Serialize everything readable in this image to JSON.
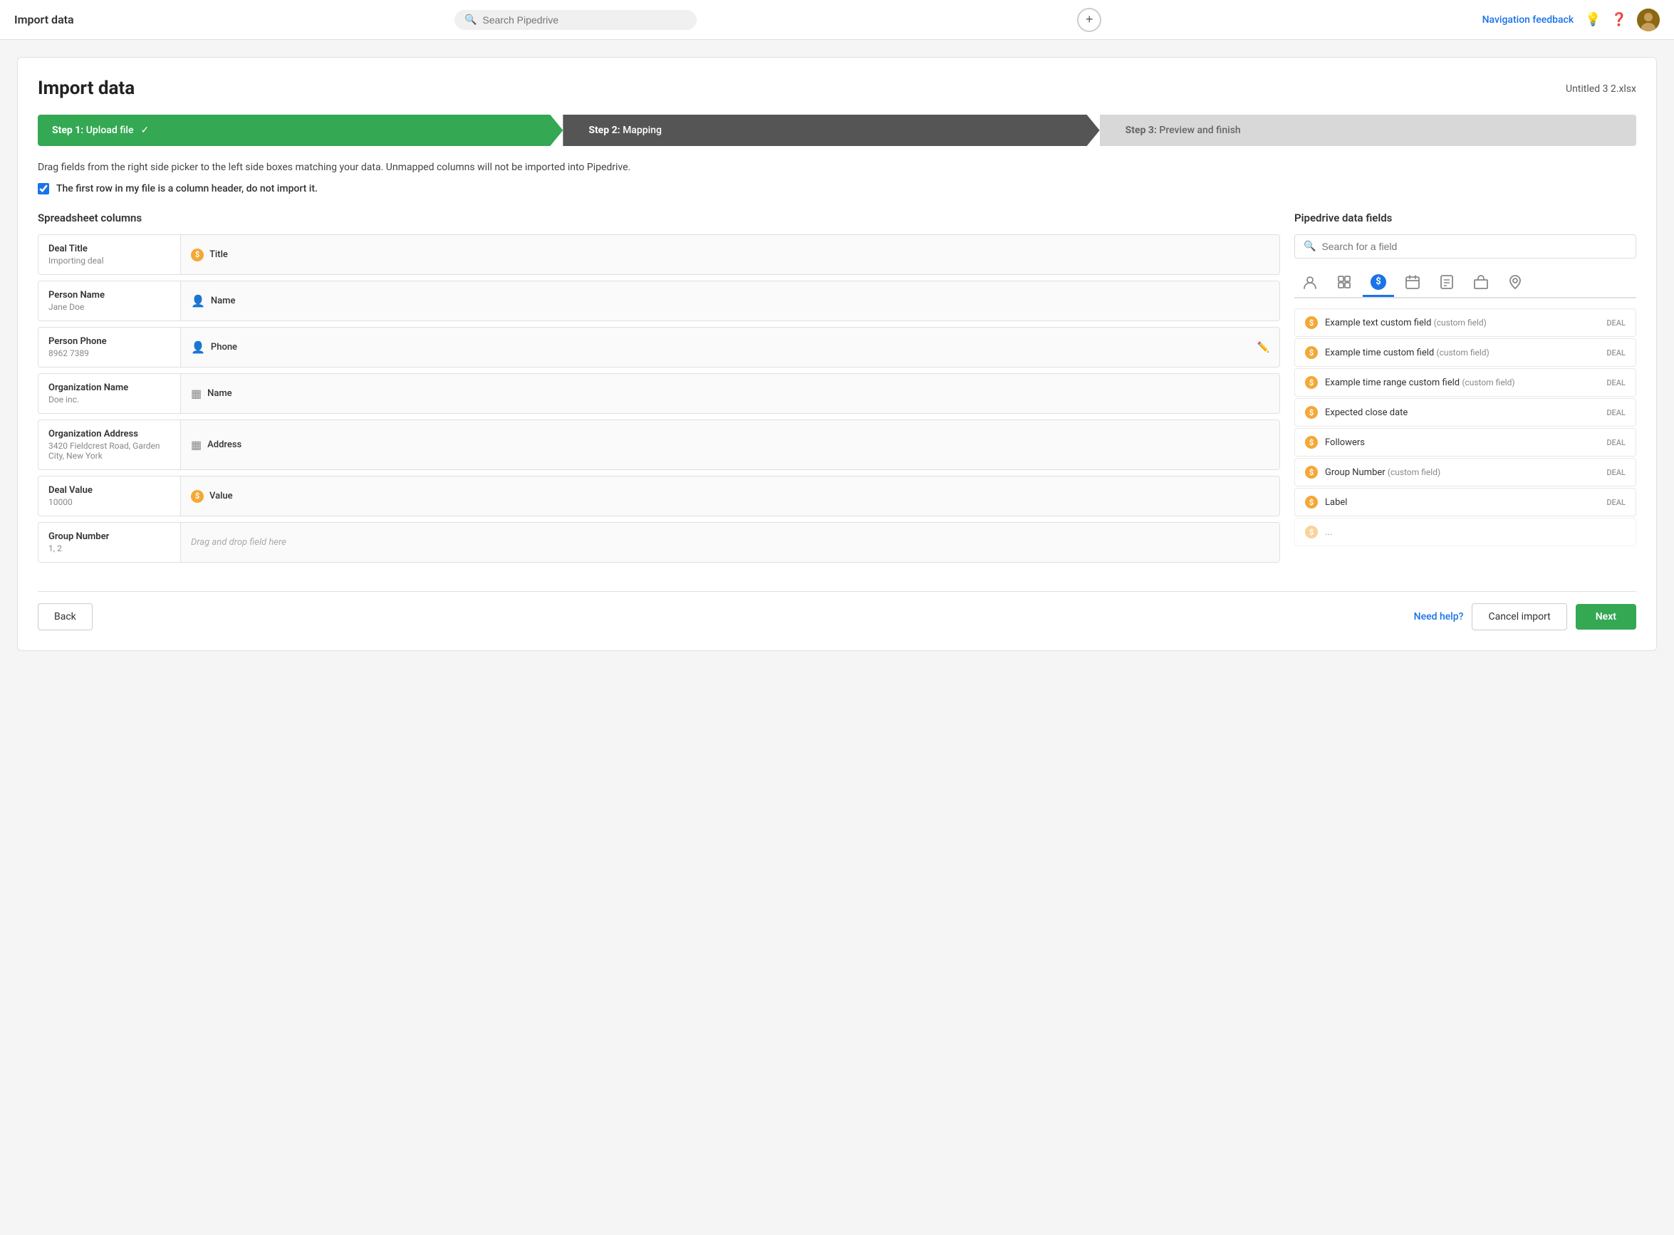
{
  "topnav": {
    "title": "Import data",
    "search_placeholder": "Search Pipedrive",
    "nav_feedback": "Navigation feedback"
  },
  "page": {
    "title": "Import data",
    "file_name": "Untitled 3 2.xlsx",
    "instruction": "Drag fields from the right side picker to the left side boxes matching your data. Unmapped columns will not be imported into Pipedrive.",
    "checkbox_label": "The first row in my file is a column header, do not import it."
  },
  "steps": [
    {
      "label": "Step 1:",
      "name": "Upload file",
      "active": true,
      "done": true
    },
    {
      "label": "Step 2:",
      "name": "Mapping",
      "active": false
    },
    {
      "label": "Step 3:",
      "name": "Preview and finish",
      "active": false
    }
  ],
  "left_pane": {
    "title": "Spreadsheet columns",
    "rows": [
      {
        "label": "Deal Title",
        "value": "Importing deal",
        "mapped_name": "Title",
        "mapped_type": "dollar"
      },
      {
        "label": "Person Name",
        "value": "Jane Doe",
        "mapped_name": "Name",
        "mapped_type": "person"
      },
      {
        "label": "Person Phone",
        "value": "8962 7389",
        "mapped_name": "Phone",
        "mapped_type": "person",
        "has_edit": true
      },
      {
        "label": "Organization Name",
        "value": "Doe inc.",
        "mapped_name": "Name",
        "mapped_type": "org"
      },
      {
        "label": "Organization Address",
        "value": "3420 Fieldcrest Road, Garden City, New York",
        "mapped_name": "Address",
        "mapped_type": "org"
      },
      {
        "label": "Deal Value",
        "value": "10000",
        "mapped_name": "Value",
        "mapped_type": "dollar"
      },
      {
        "label": "Group Number",
        "value": "1, 2",
        "mapped_name": null
      }
    ]
  },
  "right_pane": {
    "title": "Pipedrive data fields",
    "search_placeholder": "Search for a field",
    "tabs": [
      {
        "id": "person",
        "icon": "👤",
        "active": false
      },
      {
        "id": "org",
        "icon": "▦",
        "active": false
      },
      {
        "id": "deal",
        "icon": "$",
        "active": true
      },
      {
        "id": "calendar",
        "icon": "📅",
        "active": false
      },
      {
        "id": "note",
        "icon": "📋",
        "active": false
      },
      {
        "id": "product",
        "icon": "📦",
        "active": false
      },
      {
        "id": "location",
        "icon": "⊙",
        "active": false
      }
    ],
    "fields": [
      {
        "name": "Example text custom field",
        "sub": "(custom field)",
        "tag": "DEAL"
      },
      {
        "name": "Example time custom field",
        "sub": "(custom field)",
        "tag": "DEAL"
      },
      {
        "name": "Example time range custom field",
        "sub": "(custom field)",
        "tag": "DEAL"
      },
      {
        "name": "Expected close date",
        "sub": "",
        "tag": "DEAL"
      },
      {
        "name": "Followers",
        "sub": "",
        "tag": "DEAL"
      },
      {
        "name": "Group Number",
        "sub": "(custom field)",
        "tag": "DEAL"
      },
      {
        "name": "Label",
        "sub": "",
        "tag": "DEAL"
      }
    ]
  },
  "bottom": {
    "back_label": "Back",
    "need_help_label": "Need help?",
    "cancel_label": "Cancel import",
    "next_label": "Next"
  },
  "drag_placeholder": "Drag and drop field here"
}
